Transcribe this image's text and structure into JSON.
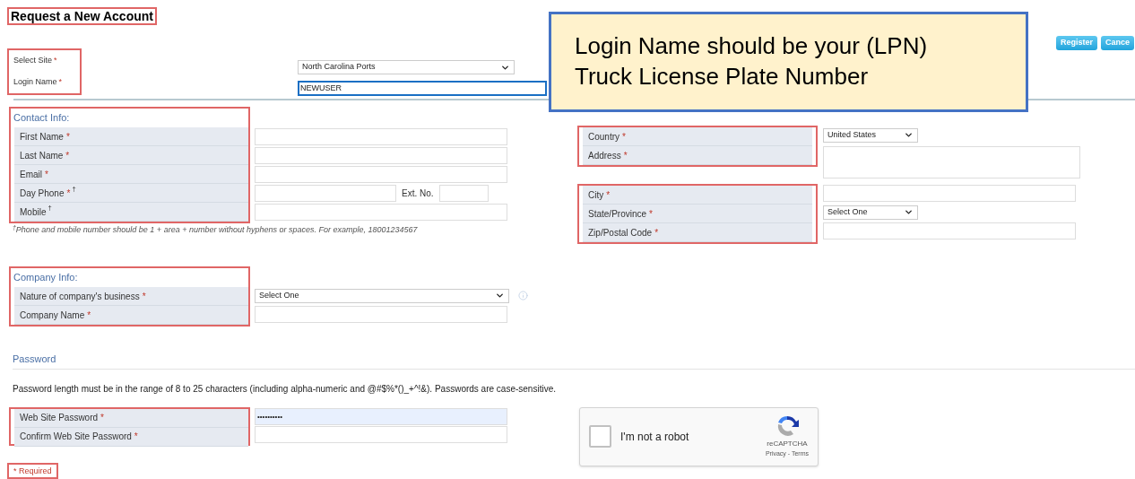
{
  "page_title": "Request a New Account",
  "buttons": [
    {
      "label": "Register"
    },
    {
      "label": "Cance"
    }
  ],
  "site": {
    "labels": [
      {
        "label": "Select Site",
        "mark": "*"
      },
      {
        "label": "Login Name",
        "mark": "*"
      }
    ],
    "site_select": "North Carolina Ports",
    "login_value": "NEWUSER"
  },
  "callout": {
    "lines": [
      "Login Name should be your (LPN)",
      "Truck License Plate Number"
    ]
  },
  "contact": {
    "heading": "Contact Info:",
    "rows": [
      {
        "kind": "text",
        "label": "First Name",
        "mark": "*"
      },
      {
        "kind": "text",
        "label": "Last Name",
        "mark": "*"
      },
      {
        "kind": "text",
        "label": "Email",
        "mark": "*"
      },
      {
        "kind": "phone",
        "label": "Day Phone",
        "mark": "*",
        "note": "†",
        "ext_label": "Ext. No."
      },
      {
        "kind": "text",
        "label": "Mobile",
        "note": "†"
      }
    ],
    "footnote": "$^{†}$Phone and mobile number should be 1 + area + number without hyphens or spaces. For example, 18001234567"
  },
  "address": {
    "groups": [
      [
        {
          "kind": "select",
          "label": "Country",
          "mark": "*",
          "value": "United States"
        },
        {
          "kind": "textarea",
          "label": "Address",
          "mark": "*"
        }
      ],
      [
        {
          "kind": "text",
          "label": "City",
          "mark": "*"
        },
        {
          "kind": "select",
          "label": "State/Province",
          "mark": "*",
          "value": "Select One"
        },
        {
          "kind": "text",
          "label": "Zip/Postal Code",
          "mark": "*"
        }
      ]
    ]
  },
  "company": {
    "heading": "Company Info:",
    "rows": [
      {
        "kind": "select",
        "label": "Nature of company's business",
        "mark": "*",
        "value": "Select One"
      },
      {
        "kind": "text",
        "label": "Company Name",
        "mark": "*"
      }
    ]
  },
  "password": {
    "heading": "Password",
    "rule": "Password length must be in the range of 8 to 25 characters (including alpha-numeric and @#$%*()_+^!&). Passwords are case-sensitive.",
    "rows": [
      {
        "label": "Web Site Password",
        "mark": "*",
        "value": "••••••••••"
      },
      {
        "label": "Confirm Web Site Password",
        "mark": "*"
      }
    ]
  },
  "captcha": {
    "checked": false,
    "label": "I'm not a robot",
    "brand": "reCAPTCHA",
    "links": "Privacy - Terms"
  },
  "required_note": "* Required"
}
